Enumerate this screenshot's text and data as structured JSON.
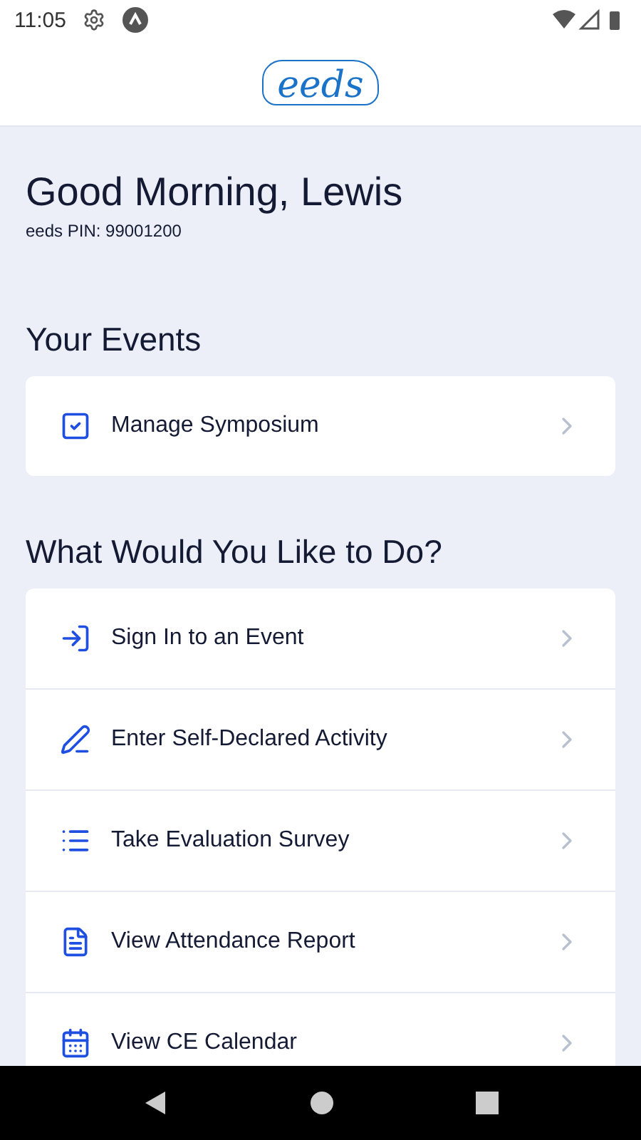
{
  "status_bar": {
    "time": "11:05"
  },
  "logo": {
    "text": "eeds"
  },
  "greeting": "Good Morning, Lewis",
  "pin": "eeds PIN: 99001200",
  "events": {
    "title": "Your Events",
    "items": [
      {
        "label": "Manage Symposium"
      }
    ]
  },
  "actions": {
    "title": "What Would You Like to Do?",
    "items": [
      {
        "label": "Sign In to an Event"
      },
      {
        "label": "Enter Self-Declared Activity"
      },
      {
        "label": "Take Evaluation Survey"
      },
      {
        "label": "View Attendance Report"
      },
      {
        "label": "View CE Calendar"
      }
    ]
  }
}
